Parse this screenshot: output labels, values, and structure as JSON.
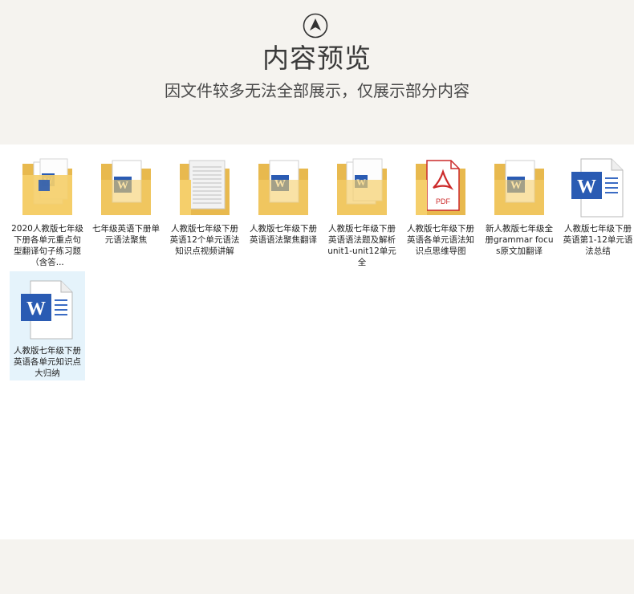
{
  "header": {
    "title": "内容预览",
    "subtitle": "因文件较多无法全部展示，仅展示部分内容"
  },
  "files": [
    {
      "label": "2020人教版七年级下册各单元重点句型翻译句子练习题（含答...",
      "icon": "folder-word-icon"
    },
    {
      "label": "七年级英语下册单元语法聚焦",
      "icon": "folder-word-icon"
    },
    {
      "label": "人教版七年级下册英语12个单元语法知识点视频讲解",
      "icon": "folder-doc-icon"
    },
    {
      "label": "人教版七年级下册英语语法聚焦翻译",
      "icon": "folder-word-icon"
    },
    {
      "label": "人教版七年级下册英语语法题及解析unit1-unit12单元全",
      "icon": "folder-word-icon"
    },
    {
      "label": "人教版七年级下册英语各单元语法知识点思维导图",
      "icon": "folder-pdf-icon"
    },
    {
      "label": "新人教版七年级全册grammar focus原文加翻译",
      "icon": "folder-word-icon"
    },
    {
      "label": "人教版七年级下册英语第1-12单元语法总结",
      "icon": "word-doc-icon"
    },
    {
      "label": "人教版七年级下册英语各单元知识点大归纳",
      "icon": "word-doc-icon"
    }
  ]
}
